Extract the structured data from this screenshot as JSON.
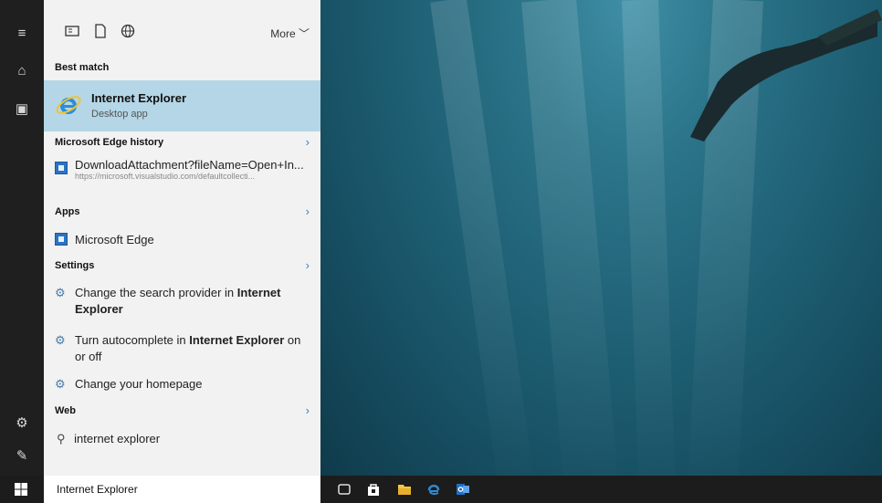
{
  "top_icons": [
    "documents-icon",
    "file-icon",
    "globe-icon"
  ],
  "more_label": "More",
  "best_match": {
    "header": "Best match",
    "title": "Internet Explorer",
    "subtitle": "Desktop app"
  },
  "edge_history": {
    "header": "Microsoft Edge history",
    "item_title": "DownloadAttachment?fileName=Open+In...",
    "item_url": "https://microsoft.visualstudio.com/defaultcollecti..."
  },
  "apps": {
    "header": "Apps",
    "item": "Microsoft Edge"
  },
  "settings": {
    "header": "Settings",
    "items": [
      {
        "line1_pre": "Change the search provider in ",
        "line1_bold": "Internet",
        "line2_bold": "Explorer",
        "line2_post": ""
      },
      {
        "line1_pre": "Turn autocomplete in ",
        "line1_bold": "Internet Explorer",
        "line1_post": " on",
        "line2_post": "or off"
      },
      {
        "line1_pre": "Change your homepage"
      }
    ]
  },
  "web": {
    "header": "Web",
    "item": "internet explorer"
  },
  "search": {
    "value": "Internet Explorer"
  },
  "colors": {
    "accent": "#3b82c4",
    "selection": "#b4d6e6",
    "taskbar": "#1c1c1c"
  }
}
